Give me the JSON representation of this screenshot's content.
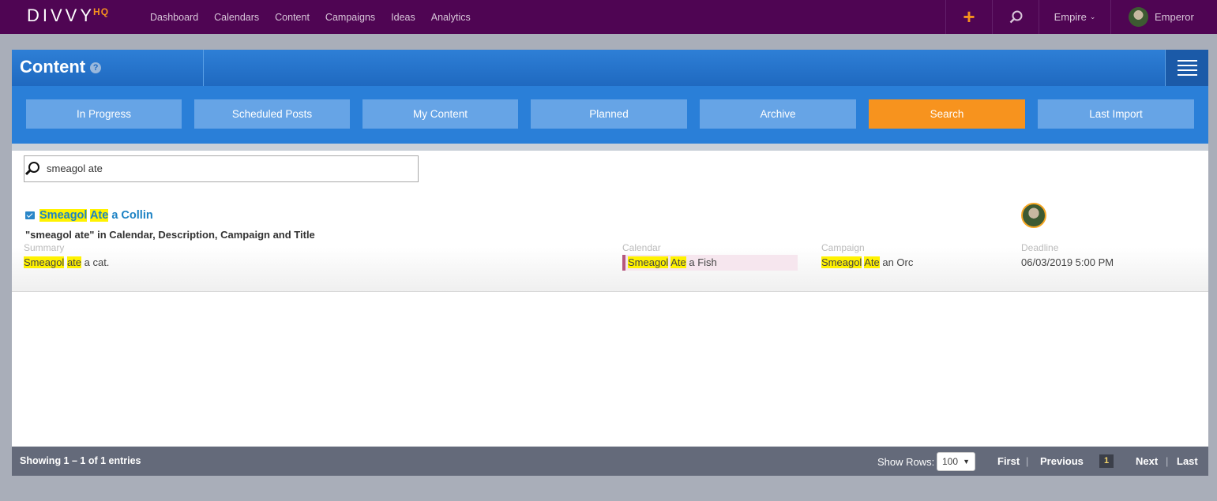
{
  "brand": {
    "name": "DIVVY",
    "suffix": "HQ"
  },
  "topnav": {
    "links": [
      "Dashboard",
      "Calendars",
      "Content",
      "Campaigns",
      "Ideas",
      "Analytics"
    ],
    "add_label": "+",
    "workspace": "Empire",
    "user": "Emperor"
  },
  "panel": {
    "title": "Content",
    "help": "?"
  },
  "tabs": [
    {
      "label": "In Progress",
      "active": false
    },
    {
      "label": "Scheduled Posts",
      "active": false
    },
    {
      "label": "My Content",
      "active": false
    },
    {
      "label": "Planned",
      "active": false
    },
    {
      "label": "Archive",
      "active": false
    },
    {
      "label": "Search",
      "active": true
    },
    {
      "label": "Last Import",
      "active": false
    }
  ],
  "search": {
    "value": "smeagol ate"
  },
  "result": {
    "title": {
      "hl1": "Smeagol",
      "sp1": " ",
      "hl2": "Ate",
      "rest": " a Collin"
    },
    "match_text": "\"smeagol ate\" in Calendar, Description, Campaign and Title",
    "summary_label": "Summary",
    "summary": {
      "hl1": "Smeagol",
      "sp1": " ",
      "hl2": "ate",
      "rest": " a cat."
    },
    "calendar_label": "Calendar",
    "calendar": {
      "hl1": "Smeagol",
      "sp1": " ",
      "hl2": "Ate",
      "rest": " a Fish"
    },
    "campaign_label": "Campaign",
    "campaign": {
      "hl1": "Smeagol",
      "sp1": " ",
      "hl2": "Ate",
      "rest": " an Orc"
    },
    "deadline_label": "Deadline",
    "deadline": "06/03/2019 5:00 PM"
  },
  "footer": {
    "showing": "Showing 1 – 1 of 1 entries",
    "rows_label": "Show Rows:",
    "rows_value": "100",
    "first": "First",
    "previous": "Previous",
    "page": "1",
    "next": "Next",
    "last": "Last",
    "sep": "|"
  },
  "colors": {
    "nav_bg": "#4f0553",
    "accent": "#f7931e",
    "tab": "#66a4e6",
    "highlight": "#fff200"
  }
}
